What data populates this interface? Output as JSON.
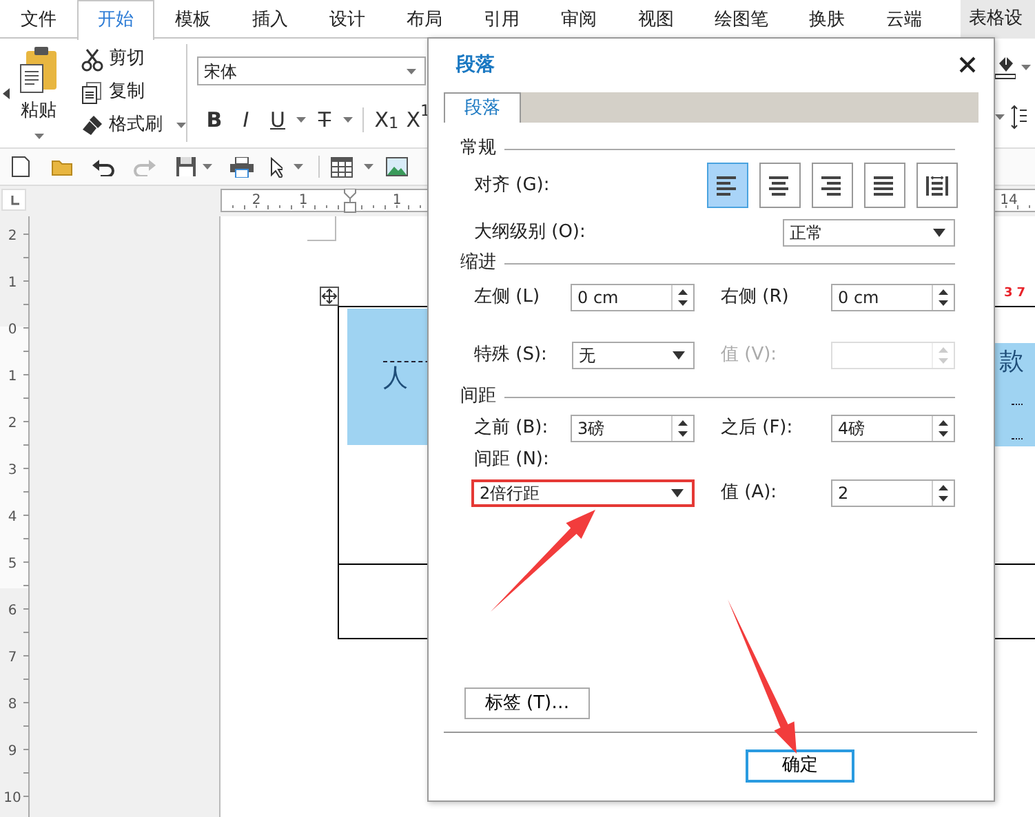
{
  "menu_tabs": [
    {
      "label": "文件",
      "selected": false
    },
    {
      "label": "开始",
      "selected": true
    },
    {
      "label": "模板",
      "selected": false
    },
    {
      "label": "插入",
      "selected": false
    },
    {
      "label": "设计",
      "selected": false
    },
    {
      "label": "布局",
      "selected": false
    },
    {
      "label": "引用",
      "selected": false
    },
    {
      "label": "审阅",
      "selected": false
    },
    {
      "label": "视图",
      "selected": false
    },
    {
      "label": "绘图笔",
      "selected": false
    },
    {
      "label": "换肤",
      "selected": false
    },
    {
      "label": "云端",
      "selected": false
    },
    {
      "label": "表格设",
      "selected": false
    }
  ],
  "ribbon": {
    "paste_label": "粘贴",
    "clipboard": [
      {
        "kind": "cut",
        "label": "剪切"
      },
      {
        "kind": "copy",
        "label": "复制"
      },
      {
        "kind": "brush",
        "label": "格式刷"
      }
    ],
    "font_name": "宋体",
    "format_buttons": [
      {
        "kind": "bold",
        "label": "B"
      },
      {
        "kind": "italic",
        "label": "I"
      },
      {
        "kind": "underline",
        "label": "U"
      },
      {
        "kind": "strike",
        "label": "T"
      },
      {
        "kind": "sub",
        "label": "X$_{1}$"
      },
      {
        "kind": "sup",
        "label": "X$^{1}$"
      }
    ]
  },
  "rulers": {
    "horizontal": [
      "2",
      "1",
      "1",
      "14"
    ],
    "vertical": [
      "2",
      "1",
      "0",
      "1",
      "2",
      "3",
      "4",
      "5",
      "6",
      "7",
      "8",
      "9",
      "10"
    ]
  },
  "document": {
    "red_text": "37",
    "cell_text": "人",
    "side_text": "款"
  },
  "dialog": {
    "title": "段落",
    "tabs": [
      {
        "label": "段落",
        "selected": true
      }
    ],
    "general": {
      "title": "常规",
      "align_label": "对齐 (G):",
      "alignments": [
        {
          "kind": "left",
          "selected": true
        },
        {
          "kind": "center",
          "selected": false
        },
        {
          "kind": "right",
          "selected": false
        },
        {
          "kind": "justify",
          "selected": false
        },
        {
          "kind": "distributed",
          "selected": false
        }
      ],
      "outline_label": "大纲级别 (O):",
      "outline_value": "正常"
    },
    "indent": {
      "title": "缩进",
      "left_label": "左侧 (L)",
      "left_value": "0 cm",
      "right_label": "右侧 (R)",
      "right_value": "0 cm",
      "special_label": "特殊 (S):",
      "special_value": "无",
      "value_label": "值 (V):",
      "value_disabled": true
    },
    "spacing": {
      "title": "间距",
      "before_label": "之前 (B):",
      "before_value": "3磅",
      "after_label": "之后 (F):",
      "after_value": "4磅",
      "line_label": "间距 (N):",
      "line_value": "2倍行距",
      "line_highlighted": true,
      "value_label": "值 (A):",
      "value": "2"
    },
    "tabs_button": "标签 (T)…",
    "ok_button": "确定"
  }
}
